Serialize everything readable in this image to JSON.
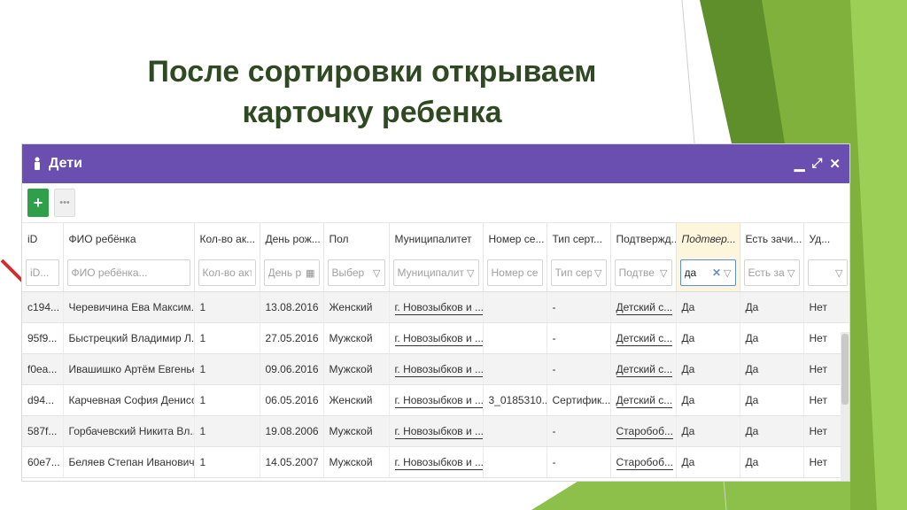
{
  "slide": {
    "title_line1": "После сортировки открываем",
    "title_line2": "карточку ребенка",
    "colors": {
      "title": "#2f4a22",
      "green_light": "#8cc04a",
      "green_dark": "#5e8f2b",
      "arrow": "#d62b2b"
    }
  },
  "window": {
    "icon": "child-icon",
    "title": "Дети",
    "controls": {
      "minimize": "▁",
      "restore": "⤢",
      "close": "✕"
    },
    "accent": "#6a4fb1"
  },
  "toolbar": {
    "add_label": "+",
    "more_label": "•••"
  },
  "columns": [
    {
      "id": "id",
      "header": "iD",
      "placeholder": "iD...",
      "icon": ""
    },
    {
      "id": "name",
      "header": "ФИО ребёнка",
      "placeholder": "ФИО ребёнка...",
      "icon": ""
    },
    {
      "id": "count",
      "header": "Кол-во ак...",
      "placeholder": "Кол-во акт",
      "icon": ""
    },
    {
      "id": "birthday",
      "header": "День рож...",
      "placeholder": "День р",
      "icon": "calendar-icon"
    },
    {
      "id": "gender",
      "header": "Пол",
      "placeholder": "Выбер",
      "icon": "dropdown-icon"
    },
    {
      "id": "municipality",
      "header": "Муниципалитет",
      "placeholder": "Муниципалит",
      "icon": "dropdown-icon"
    },
    {
      "id": "cert_number",
      "header": "Номер се...",
      "placeholder": "Номер сер",
      "icon": ""
    },
    {
      "id": "cert_type",
      "header": "Тип серт...",
      "placeholder": "Тип сер",
      "icon": "dropdown-icon"
    },
    {
      "id": "confirmed_by",
      "header": "Подтвержд...",
      "placeholder": "Подтве",
      "icon": "dropdown-icon"
    },
    {
      "id": "confirmed",
      "header": "Подтвер...",
      "placeholder": "да",
      "icon": "clear-and-dropdown",
      "active": true
    },
    {
      "id": "enrolled",
      "header": "Есть зачи...",
      "placeholder": "Есть за",
      "icon": "dropdown-icon"
    },
    {
      "id": "deleted",
      "header": "Уд...",
      "placeholder": "",
      "icon": "dropdown-icon"
    }
  ],
  "rows": [
    [
      "c194...",
      "Черевичина Ева Максим...",
      "1",
      "13.08.2016",
      "Женский",
      "г. Новозыбков и ...",
      "",
      "-",
      "Детский с...",
      "Да",
      "Да",
      "Нет"
    ],
    [
      "95f9...",
      "Быстрецкий Владимир Л...",
      "1",
      "27.05.2016",
      "Мужской",
      "г. Новозыбков и ...",
      "",
      "-",
      "Детский с...",
      "Да",
      "Да",
      "Нет"
    ],
    [
      "f0ea...",
      "Ивашишко Артём Евгенье...",
      "1",
      "09.06.2016",
      "Мужской",
      "г. Новозыбков и ...",
      "",
      "-",
      "Детский с...",
      "Да",
      "Да",
      "Нет"
    ],
    [
      "d94...",
      "Карчевная София Денисо...",
      "1",
      "06.05.2016",
      "Женский",
      "г. Новозыбков и ...",
      "3_0185310...",
      "Сертифик...",
      "Детский с...",
      "Да",
      "Да",
      "Нет"
    ],
    [
      "587f...",
      "Горбачевский Никита Вл...",
      "1",
      "19.08.2006",
      "Мужской",
      "г. Новозыбков и ...",
      "",
      "-",
      "Старобоб...",
      "Да",
      "Да",
      "Нет"
    ],
    [
      "60e7...",
      "Беляев Степан Иванович",
      "1",
      "14.05.2007",
      "Мужской",
      "г. Новозыбков и ...",
      "",
      "-",
      "Старобоб...",
      "Да",
      "Да",
      "Нет"
    ]
  ]
}
